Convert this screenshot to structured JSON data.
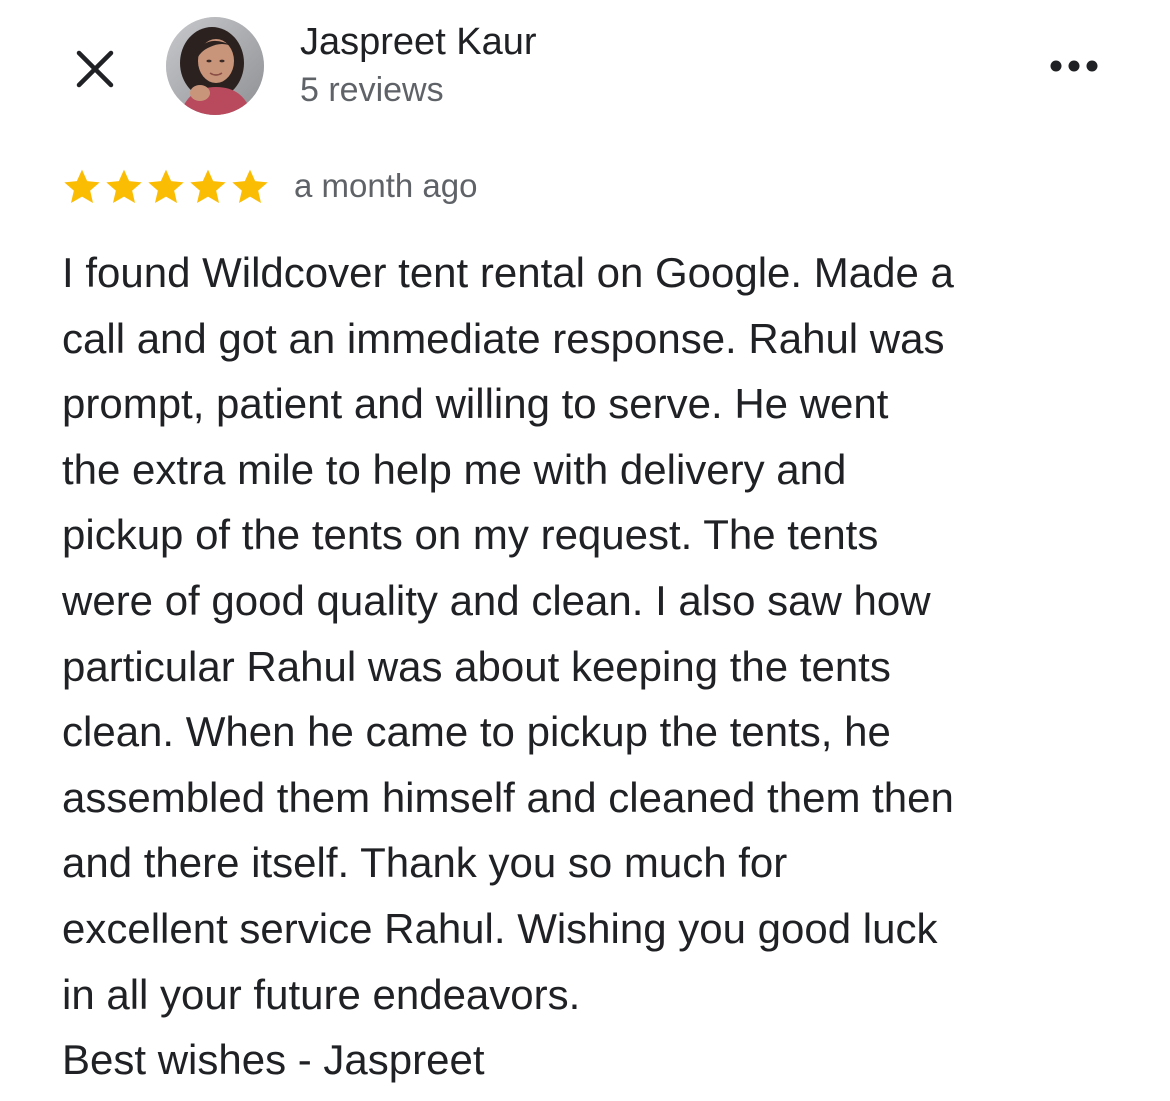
{
  "header": {
    "close_icon": "close-icon",
    "author_name": "Jaspreet Kaur",
    "review_count": "5 reviews",
    "more_icon": "more-horizontal-icon"
  },
  "review": {
    "rating": 5,
    "rating_max": 5,
    "star_color": "#fbbc04",
    "time_ago": "a month ago",
    "lines": [
      "I found Wildcover tent rental on Google. Made a",
      "call and got an immediate response. Rahul was",
      "prompt, patient and willing to serve. He went",
      "the extra mile to help me with delivery and",
      "pickup of the tents on my request. The tents",
      "were of good quality and clean. I also saw how",
      "particular Rahul was about keeping the tents",
      "clean. When he came to pickup the tents, he",
      "assembled them himself and cleaned them then",
      "and there itself. Thank you so much for",
      "excellent service Rahul. Wishing you good luck",
      "in all your future endeavors.",
      "Best wishes - Jaspreet"
    ]
  }
}
